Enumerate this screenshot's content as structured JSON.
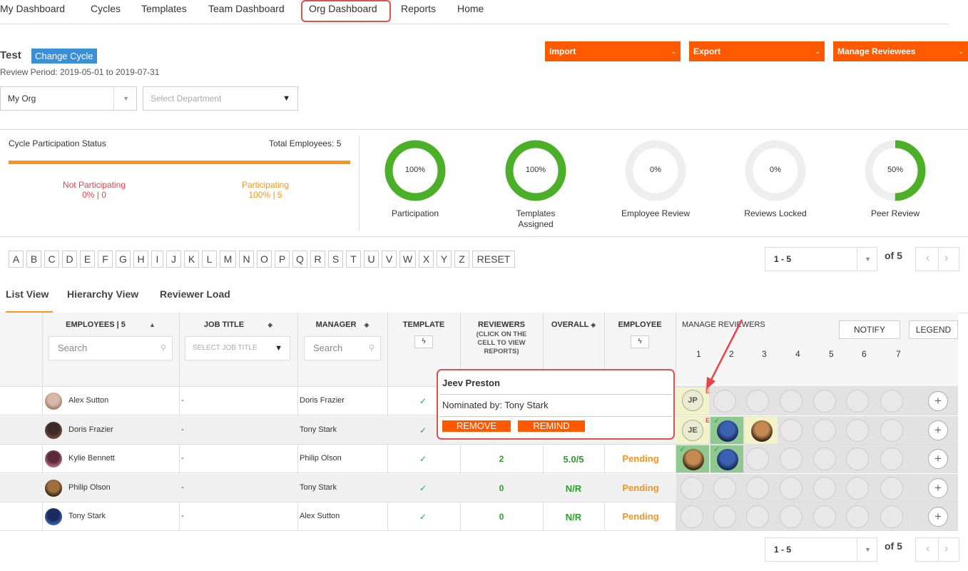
{
  "nav": {
    "items": [
      "My Dashboard",
      "Cycles",
      "Templates",
      "Team Dashboard",
      "Org Dashboard",
      "Reports",
      "Home"
    ]
  },
  "cycle": {
    "name": "Test",
    "change_label": "Change Cycle",
    "review_period": "Review Period: 2019-05-01 to 2019-07-31"
  },
  "actions": {
    "import": "Import",
    "export": "Export",
    "manage_reviewees": "Manage Reviewees"
  },
  "filters": {
    "org": "My Org",
    "department_placeholder": "Select Department"
  },
  "participation": {
    "title": "Cycle Participation Status",
    "total": "Total Employees: 5",
    "not_participating_label": "Not Participating",
    "not_participating_value": "0% | 0",
    "participating_label": "Participating",
    "participating_value": "100% | 5"
  },
  "donuts": [
    {
      "value": "100%",
      "label": "Participation",
      "fraction": 1.0
    },
    {
      "value": "100%",
      "label": "Templates Assigned",
      "fraction": 1.0
    },
    {
      "value": "0%",
      "label": "Employee Review",
      "fraction": 0.0
    },
    {
      "value": "0%",
      "label": "Reviews Locked",
      "fraction": 0.0
    },
    {
      "value": "50%",
      "label": "Peer Review",
      "fraction": 0.5
    }
  ],
  "colors": {
    "accent_orange": "#ff5a00",
    "donut_green": "#4caf28",
    "donut_track": "#eeeeee",
    "highlight_red": "#d9534f"
  },
  "alphabet": [
    "A",
    "B",
    "C",
    "D",
    "E",
    "F",
    "G",
    "H",
    "I",
    "J",
    "K",
    "L",
    "M",
    "N",
    "O",
    "P",
    "Q",
    "R",
    "S",
    "T",
    "U",
    "V",
    "W",
    "X",
    "Y",
    "Z",
    "RESET"
  ],
  "pager": {
    "range": "1 - 5",
    "of": "of 5"
  },
  "tabs": [
    "List View",
    "Hierarchy View",
    "Reviewer Load"
  ],
  "table": {
    "headers": {
      "employees": "EMPLOYEES | 5",
      "job_title": "JOB TITLE",
      "manager": "MANAGER",
      "template": "TEMPLATE",
      "reviewers": "REVIEWERS",
      "reviewers_note": "(CLICK ON THE CELL TO VIEW REPORTS)",
      "overall": "OVERALL",
      "employee": "EMPLOYEE",
      "manage_reviewers": "MANAGE REVIEWERS"
    },
    "search_placeholder": "Search",
    "job_title_placeholder": "SELECT JOB TITLE",
    "manager_search_placeholder": "Search",
    "notify": "NOTIFY",
    "legend": "LEGEND",
    "reviewer_slots": [
      "1",
      "2",
      "3",
      "4",
      "5",
      "6",
      "7"
    ],
    "rows": [
      {
        "name": "Alex Sutton",
        "job": "-",
        "manager": "Doris Frazier",
        "template": "✓",
        "reviewers": "",
        "overall": "",
        "employee": ""
      },
      {
        "name": "Doris Frazier",
        "job": "-",
        "manager": "Tony Stark",
        "template": "✓",
        "reviewers": "",
        "overall": "",
        "employee": ""
      },
      {
        "name": "Kylie Bennett",
        "job": "-",
        "manager": "Philip Olson",
        "template": "✓",
        "reviewers": "2",
        "overall": "5.0/5",
        "employee": "Pending"
      },
      {
        "name": "Philip Olson",
        "job": "-",
        "manager": "Tony Stark",
        "template": "✓",
        "reviewers": "0",
        "overall": "N/R",
        "employee": "Pending"
      },
      {
        "name": "Tony Stark",
        "job": "-",
        "manager": "Alex Sutton",
        "template": "✓",
        "reviewers": "0",
        "overall": "N/R",
        "employee": "Pending"
      }
    ],
    "initials": {
      "jp": "JP",
      "je": "JE",
      "e_flag": "E"
    }
  },
  "popup": {
    "name": "Jeev Preston",
    "nominated_by": "Nominated by: Tony Stark",
    "remove": "REMOVE",
    "remind": "REMIND"
  }
}
